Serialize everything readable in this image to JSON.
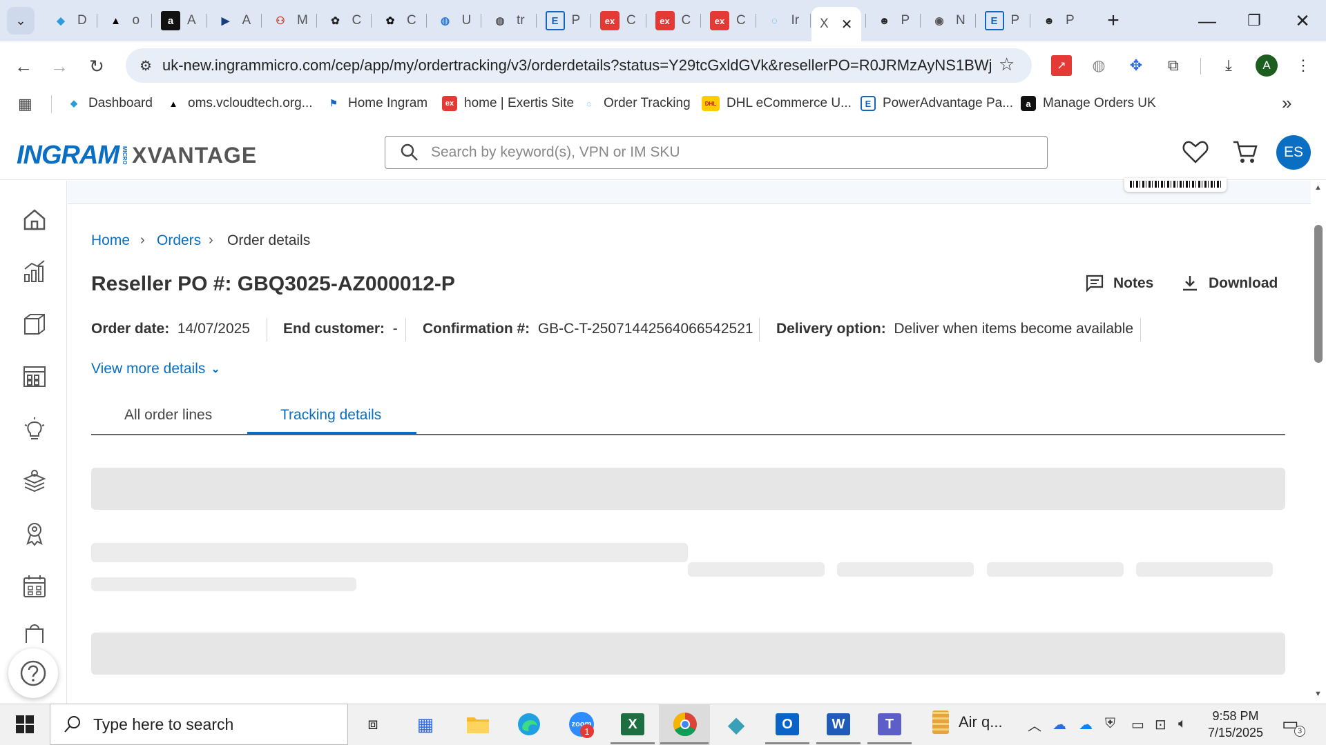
{
  "browser": {
    "tabs": [
      {
        "label": "D",
        "icon": "diamond-icon",
        "color": "#2d9cdb"
      },
      {
        "label": "o",
        "icon": "triangle-icon",
        "color": "#000000"
      },
      {
        "label": "A",
        "icon": "amazon-icon",
        "color": "#000000"
      },
      {
        "label": "A",
        "icon": "arrow-icon",
        "color": "#1a3d7c"
      },
      {
        "label": "M",
        "icon": "people-icon",
        "color": "#c0392b"
      },
      {
        "label": "C",
        "icon": "openai-icon",
        "color": "#222222"
      },
      {
        "label": "C",
        "icon": "openai-icon",
        "color": "#111111"
      },
      {
        "label": "U",
        "icon": "globe-icon",
        "color": "#2d7be5"
      },
      {
        "label": "tr",
        "icon": "globe-icon",
        "color": "#555555"
      },
      {
        "label": "P",
        "icon": "e-icon",
        "color": "#1565c0"
      },
      {
        "label": "C",
        "icon": "exertis-icon",
        "color": "#e53935"
      },
      {
        "label": "C",
        "icon": "exertis-icon",
        "color": "#e53935"
      },
      {
        "label": "C",
        "icon": "exertis-icon",
        "color": "#e53935"
      },
      {
        "label": "Ir",
        "icon": "spinner-icon",
        "color": "#2aa8c9"
      },
      {
        "label": "X",
        "icon": "xvantage-icon",
        "color": "#222222"
      },
      {
        "label": "P",
        "icon": "face-icon",
        "color": "#222222"
      },
      {
        "label": "N",
        "icon": "chrome-icon",
        "color": "#555555"
      },
      {
        "label": "P",
        "icon": "e-icon",
        "color": "#1565c0"
      },
      {
        "label": "P",
        "icon": "face-icon",
        "color": "#222222"
      }
    ],
    "new_tab": "+",
    "url": "uk-new.ingrammicro.com/cep/app/my/ordertracking/v3/orderdetails?status=Y29tcGxldGVk&resellerPO=R0JRMzAyNS1BWjAw...",
    "profile_initial": "A",
    "bookmarks": [
      {
        "label": "Dashboard",
        "icon": "diamond-icon",
        "color": "#2d9cdb"
      },
      {
        "label": "oms.vcloudtech.org...",
        "icon": "triangle-icon",
        "color": "#000000"
      },
      {
        "label": "Home Ingram",
        "icon": "flag-icon",
        "color": "#1565c0"
      },
      {
        "label": "home | Exertis Site",
        "icon": "exertis-icon",
        "color": "#e53935"
      },
      {
        "label": "Order Tracking",
        "icon": "spinner-icon",
        "color": "#2aa8c9"
      },
      {
        "label": "DHL eCommerce U...",
        "icon": "dhl-icon",
        "color": "#ffcc00"
      },
      {
        "label": "PowerAdvantage Pa...",
        "icon": "e-icon",
        "color": "#1565c0"
      },
      {
        "label": "Manage Orders UK",
        "icon": "amazon-icon",
        "color": "#000000"
      }
    ],
    "more_bookmarks": "»"
  },
  "site": {
    "logo_main": "INGRAM",
    "logo_micro": "MICRO",
    "logo_xvantage": "XVANTAGE",
    "search_placeholder": "Search by keyword(s), VPN or IM SKU",
    "user_initials": "ES",
    "brand_color": "#0a6ec2"
  },
  "breadcrumb": {
    "home": "Home",
    "orders": "Orders",
    "current": "Order details"
  },
  "order": {
    "title": "Reseller PO #: GBQ3025-AZ000012-P",
    "notes_label": "Notes",
    "download_label": "Download",
    "order_date_label": "Order date:",
    "order_date": "14/07/2025",
    "end_customer_label": "End customer:",
    "end_customer": "-",
    "confirmation_label": "Confirmation #:",
    "confirmation": "GB-C-T-25071442564066542521",
    "delivery_label": "Delivery option:",
    "delivery": "Deliver when items become available",
    "view_more": "View more details"
  },
  "tabs": {
    "all_lines": "All order lines",
    "tracking": "Tracking details",
    "active": "Tracking details"
  },
  "taskbar": {
    "search_placeholder": "Type here to search",
    "weather": "Air q...",
    "time": "9:58 PM",
    "date": "7/15/2025",
    "notification_count": "3",
    "zoom_badge": "1"
  }
}
